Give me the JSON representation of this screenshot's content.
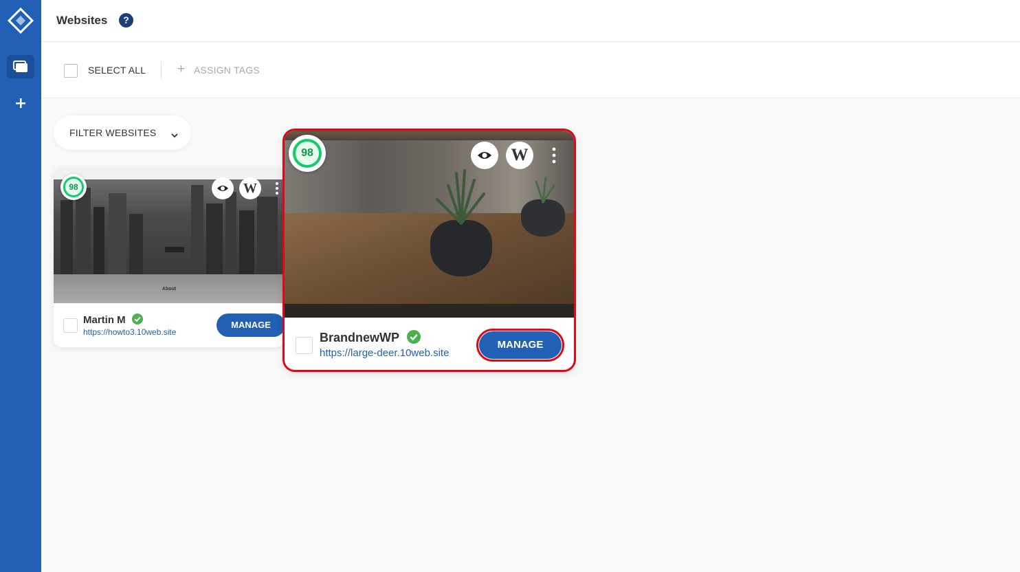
{
  "header": {
    "title": "Websites",
    "help_label": "?"
  },
  "toolbar": {
    "select_all_label": "SELECT ALL",
    "assign_tags_label": "ASSIGN TAGS"
  },
  "filter": {
    "label": "FILTER WEBSITES"
  },
  "sites": [
    {
      "name": "Martin M",
      "url": "https://howto3.10web.site",
      "score": "98",
      "manage_label": "MANAGE",
      "about_label": "About"
    },
    {
      "name": "BrandnewWP",
      "url": "https://large-deer.10web.site",
      "score": "98",
      "manage_label": "MANAGE"
    }
  ],
  "colors": {
    "sidebar": "#2160b5",
    "accent": "#2160b5",
    "score_green": "#0cce6b",
    "verified_green": "#4caf50",
    "highlight_red": "#e30613"
  },
  "icons": {
    "logo": "tenweb-logo-icon",
    "sites_nav": "websites-icon",
    "add_nav": "plus-icon",
    "help": "question-icon",
    "preview": "eye-icon",
    "wordpress": "wordpress-icon",
    "more": "more-vertical-icon",
    "verified": "check-circle-icon",
    "filter": "chevron-down-icon"
  }
}
